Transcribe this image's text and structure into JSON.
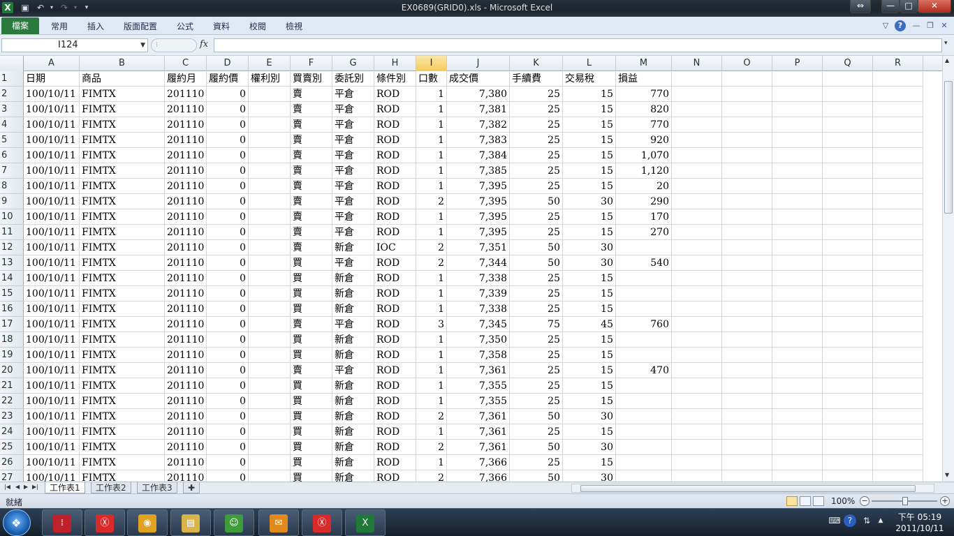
{
  "window": {
    "title": "EX0689(GRID0).xls - Microsoft Excel",
    "controls": {
      "restore": "⇔",
      "minimize": "—",
      "maximize": "□",
      "close": "✕"
    }
  },
  "quick_access": {
    "app_icon": "excel-icon",
    "save": "save-icon",
    "undo": "undo-icon",
    "redo": "redo-icon",
    "customize": "▾"
  },
  "ribbon": {
    "file_tab": "檔案",
    "tabs": [
      "常用",
      "插入",
      "版面配置",
      "公式",
      "資料",
      "校閱",
      "檢視"
    ],
    "right_tools": [
      "▽",
      "?",
      "—",
      "❐",
      "✕"
    ]
  },
  "formula_bar": {
    "name_box": "I124",
    "fx": "fx",
    "value": ""
  },
  "columns": [
    {
      "letter": "A"
    },
    {
      "letter": "B"
    },
    {
      "letter": "C"
    },
    {
      "letter": "D"
    },
    {
      "letter": "E"
    },
    {
      "letter": "F"
    },
    {
      "letter": "G"
    },
    {
      "letter": "H"
    },
    {
      "letter": "I"
    },
    {
      "letter": "J"
    },
    {
      "letter": "K"
    },
    {
      "letter": "L"
    },
    {
      "letter": "M"
    },
    {
      "letter": "N"
    },
    {
      "letter": "O"
    },
    {
      "letter": "P"
    },
    {
      "letter": "Q"
    },
    {
      "letter": "R"
    }
  ],
  "selected_column": "I",
  "header_row": [
    "日期",
    "商品",
    "履約月",
    "履約價",
    "權利別",
    "買賣別",
    "委託別",
    "條件別",
    "口數",
    "成交價",
    "手續費",
    "交易稅",
    "損益"
  ],
  "rows": [
    [
      "100/10/11",
      "FIMTX",
      "201110",
      "0",
      "",
      "賣",
      "平倉",
      "ROD",
      "1",
      "7,380",
      "25",
      "15",
      "770"
    ],
    [
      "100/10/11",
      "FIMTX",
      "201110",
      "0",
      "",
      "賣",
      "平倉",
      "ROD",
      "1",
      "7,381",
      "25",
      "15",
      "820"
    ],
    [
      "100/10/11",
      "FIMTX",
      "201110",
      "0",
      "",
      "賣",
      "平倉",
      "ROD",
      "1",
      "7,382",
      "25",
      "15",
      "770"
    ],
    [
      "100/10/11",
      "FIMTX",
      "201110",
      "0",
      "",
      "賣",
      "平倉",
      "ROD",
      "1",
      "7,383",
      "25",
      "15",
      "920"
    ],
    [
      "100/10/11",
      "FIMTX",
      "201110",
      "0",
      "",
      "賣",
      "平倉",
      "ROD",
      "1",
      "7,384",
      "25",
      "15",
      "1,070"
    ],
    [
      "100/10/11",
      "FIMTX",
      "201110",
      "0",
      "",
      "賣",
      "平倉",
      "ROD",
      "1",
      "7,385",
      "25",
      "15",
      "1,120"
    ],
    [
      "100/10/11",
      "FIMTX",
      "201110",
      "0",
      "",
      "賣",
      "平倉",
      "ROD",
      "1",
      "7,395",
      "25",
      "15",
      "20"
    ],
    [
      "100/10/11",
      "FIMTX",
      "201110",
      "0",
      "",
      "賣",
      "平倉",
      "ROD",
      "2",
      "7,395",
      "50",
      "30",
      "290"
    ],
    [
      "100/10/11",
      "FIMTX",
      "201110",
      "0",
      "",
      "賣",
      "平倉",
      "ROD",
      "1",
      "7,395",
      "25",
      "15",
      "170"
    ],
    [
      "100/10/11",
      "FIMTX",
      "201110",
      "0",
      "",
      "賣",
      "平倉",
      "ROD",
      "1",
      "7,395",
      "25",
      "15",
      "270"
    ],
    [
      "100/10/11",
      "FIMTX",
      "201110",
      "0",
      "",
      "賣",
      "新倉",
      "IOC",
      "2",
      "7,351",
      "50",
      "30",
      ""
    ],
    [
      "100/10/11",
      "FIMTX",
      "201110",
      "0",
      "",
      "買",
      "平倉",
      "ROD",
      "2",
      "7,344",
      "50",
      "30",
      "540"
    ],
    [
      "100/10/11",
      "FIMTX",
      "201110",
      "0",
      "",
      "買",
      "新倉",
      "ROD",
      "1",
      "7,338",
      "25",
      "15",
      ""
    ],
    [
      "100/10/11",
      "FIMTX",
      "201110",
      "0",
      "",
      "買",
      "新倉",
      "ROD",
      "1",
      "7,339",
      "25",
      "15",
      ""
    ],
    [
      "100/10/11",
      "FIMTX",
      "201110",
      "0",
      "",
      "買",
      "新倉",
      "ROD",
      "1",
      "7,338",
      "25",
      "15",
      ""
    ],
    [
      "100/10/11",
      "FIMTX",
      "201110",
      "0",
      "",
      "賣",
      "平倉",
      "ROD",
      "3",
      "7,345",
      "75",
      "45",
      "760"
    ],
    [
      "100/10/11",
      "FIMTX",
      "201110",
      "0",
      "",
      "買",
      "新倉",
      "ROD",
      "1",
      "7,350",
      "25",
      "15",
      ""
    ],
    [
      "100/10/11",
      "FIMTX",
      "201110",
      "0",
      "",
      "買",
      "新倉",
      "ROD",
      "1",
      "7,358",
      "25",
      "15",
      ""
    ],
    [
      "100/10/11",
      "FIMTX",
      "201110",
      "0",
      "",
      "賣",
      "平倉",
      "ROD",
      "1",
      "7,361",
      "25",
      "15",
      "470"
    ],
    [
      "100/10/11",
      "FIMTX",
      "201110",
      "0",
      "",
      "買",
      "新倉",
      "ROD",
      "1",
      "7,355",
      "25",
      "15",
      ""
    ],
    [
      "100/10/11",
      "FIMTX",
      "201110",
      "0",
      "",
      "買",
      "新倉",
      "ROD",
      "1",
      "7,355",
      "25",
      "15",
      ""
    ],
    [
      "100/10/11",
      "FIMTX",
      "201110",
      "0",
      "",
      "買",
      "新倉",
      "ROD",
      "2",
      "7,361",
      "50",
      "30",
      ""
    ],
    [
      "100/10/11",
      "FIMTX",
      "201110",
      "0",
      "",
      "買",
      "新倉",
      "ROD",
      "1",
      "7,361",
      "25",
      "15",
      ""
    ],
    [
      "100/10/11",
      "FIMTX",
      "201110",
      "0",
      "",
      "買",
      "新倉",
      "ROD",
      "2",
      "7,361",
      "50",
      "30",
      ""
    ],
    [
      "100/10/11",
      "FIMTX",
      "201110",
      "0",
      "",
      "買",
      "新倉",
      "ROD",
      "1",
      "7,366",
      "25",
      "15",
      ""
    ],
    [
      "100/10/11",
      "FIMTX",
      "201110",
      "0",
      "",
      "買",
      "新倉",
      "ROD",
      "2",
      "7,366",
      "50",
      "30",
      ""
    ]
  ],
  "sheet_tabs": [
    "工作表1",
    "工作表2",
    "工作表3"
  ],
  "active_sheet": "工作表1",
  "status": {
    "text": "就緒",
    "zoom": "100%"
  },
  "taskbar": {
    "apps": [
      {
        "name": "app-red-icon",
        "color": "#c0202a",
        "glyph": "⁞"
      },
      {
        "name": "stock-app-icon",
        "color": "#d82a2a",
        "glyph": "Ⓧ"
      },
      {
        "name": "chrome-icon",
        "color": "#e0a020",
        "glyph": "◉"
      },
      {
        "name": "folder-icon",
        "color": "#d9b448",
        "glyph": "▤"
      },
      {
        "name": "messenger-icon",
        "color": "#3f9c3a",
        "glyph": "☺"
      },
      {
        "name": "outlook-icon",
        "color": "#e08a1e",
        "glyph": "✉"
      },
      {
        "name": "stock-app-2-icon",
        "color": "#d82a2a",
        "glyph": "Ⓧ"
      },
      {
        "name": "excel-taskbar-icon",
        "color": "#1f7a3a",
        "glyph": "X"
      }
    ],
    "clock_time": "下午 05:19",
    "clock_date": "2011/10/11"
  },
  "colors": {
    "file_tab": "#2b7a3d",
    "selected_header": "#f6c95a",
    "title_bar": "#1d242c"
  }
}
